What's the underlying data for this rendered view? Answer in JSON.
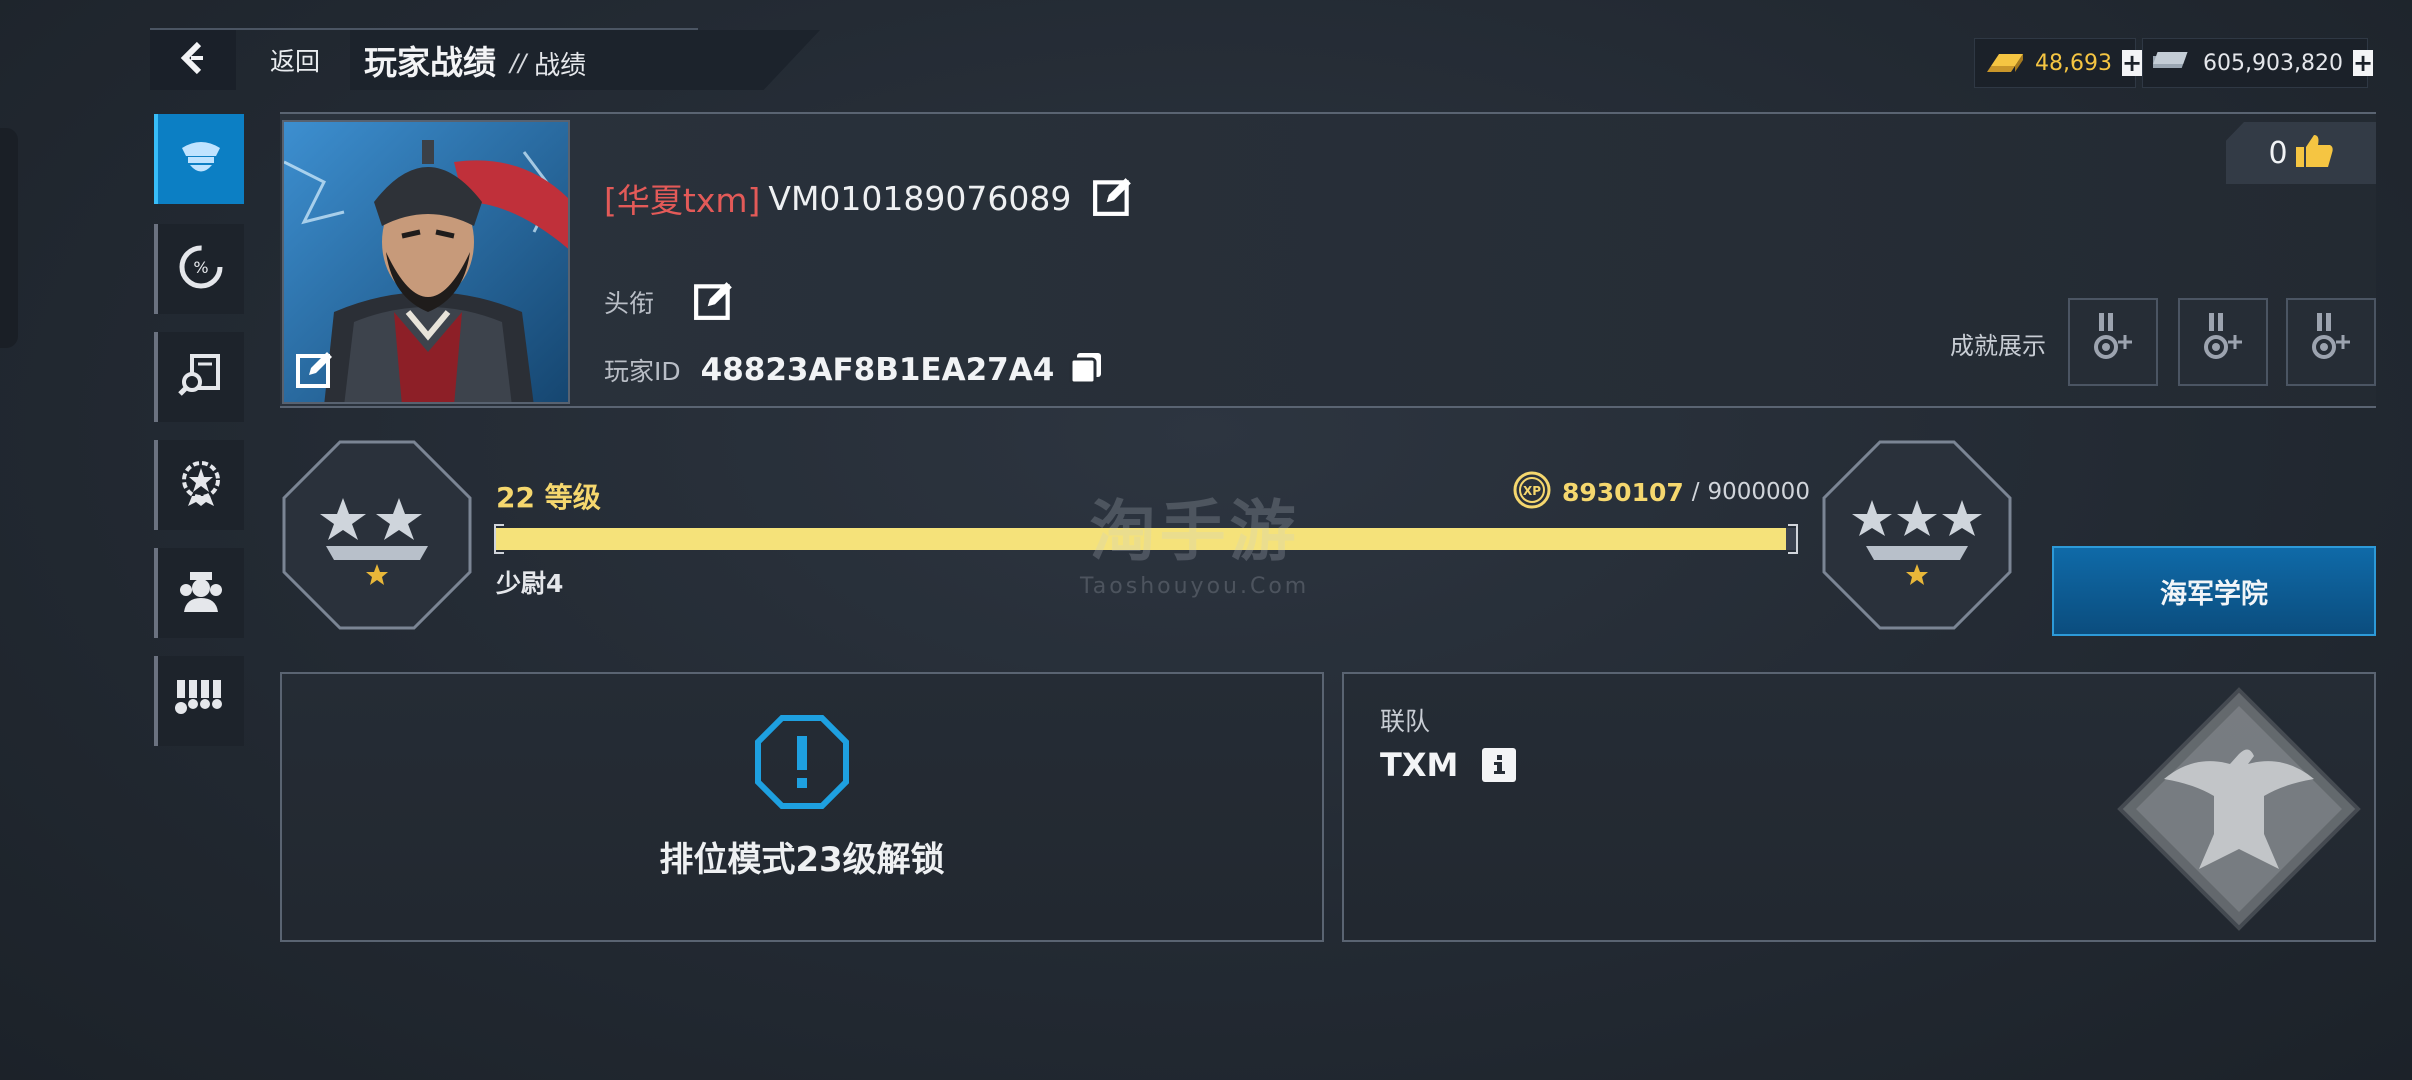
{
  "header": {
    "back_label": "返回",
    "title": "玩家战绩",
    "separator": "//",
    "subtitle": "战绩"
  },
  "currency": {
    "gold": "48,693",
    "cash": "605,903,820",
    "gold_color": "#f5c542",
    "cash_color": "#e5e7eb"
  },
  "sidebar": {
    "items": [
      {
        "icon": "officer-cap-icon",
        "active": true
      },
      {
        "icon": "percent-gauge-icon",
        "active": false
      },
      {
        "icon": "search-book-icon",
        "active": false
      },
      {
        "icon": "star-emblem-icon",
        "active": false
      },
      {
        "icon": "crew-icon",
        "active": false
      },
      {
        "icon": "medals-icon",
        "active": false
      }
    ]
  },
  "profile": {
    "clan_tag": "[华夏txm]",
    "player_name": "VM010189076089",
    "title_label": "头衔",
    "id_label": "玩家ID",
    "player_id": "48823AF8B1EA27A4",
    "likes": "0",
    "achievement_label": "成就展示"
  },
  "level": {
    "level_text": "22 等级",
    "rank_name": "少尉4",
    "xp_current": "8930107",
    "xp_separator": "/",
    "xp_max": "9000000",
    "progress": 0.992,
    "academy_button": "海军学院"
  },
  "watermark": {
    "main": "淘手游",
    "sub": "Taoshouyou.Com"
  },
  "ranked": {
    "text": "排位模式23级解锁"
  },
  "alliance": {
    "label": "联队",
    "name": "TXM"
  },
  "colors": {
    "accent": "#0c7fc4",
    "xp_yellow": "#f5e27a",
    "clan_red": "#e35a58"
  }
}
